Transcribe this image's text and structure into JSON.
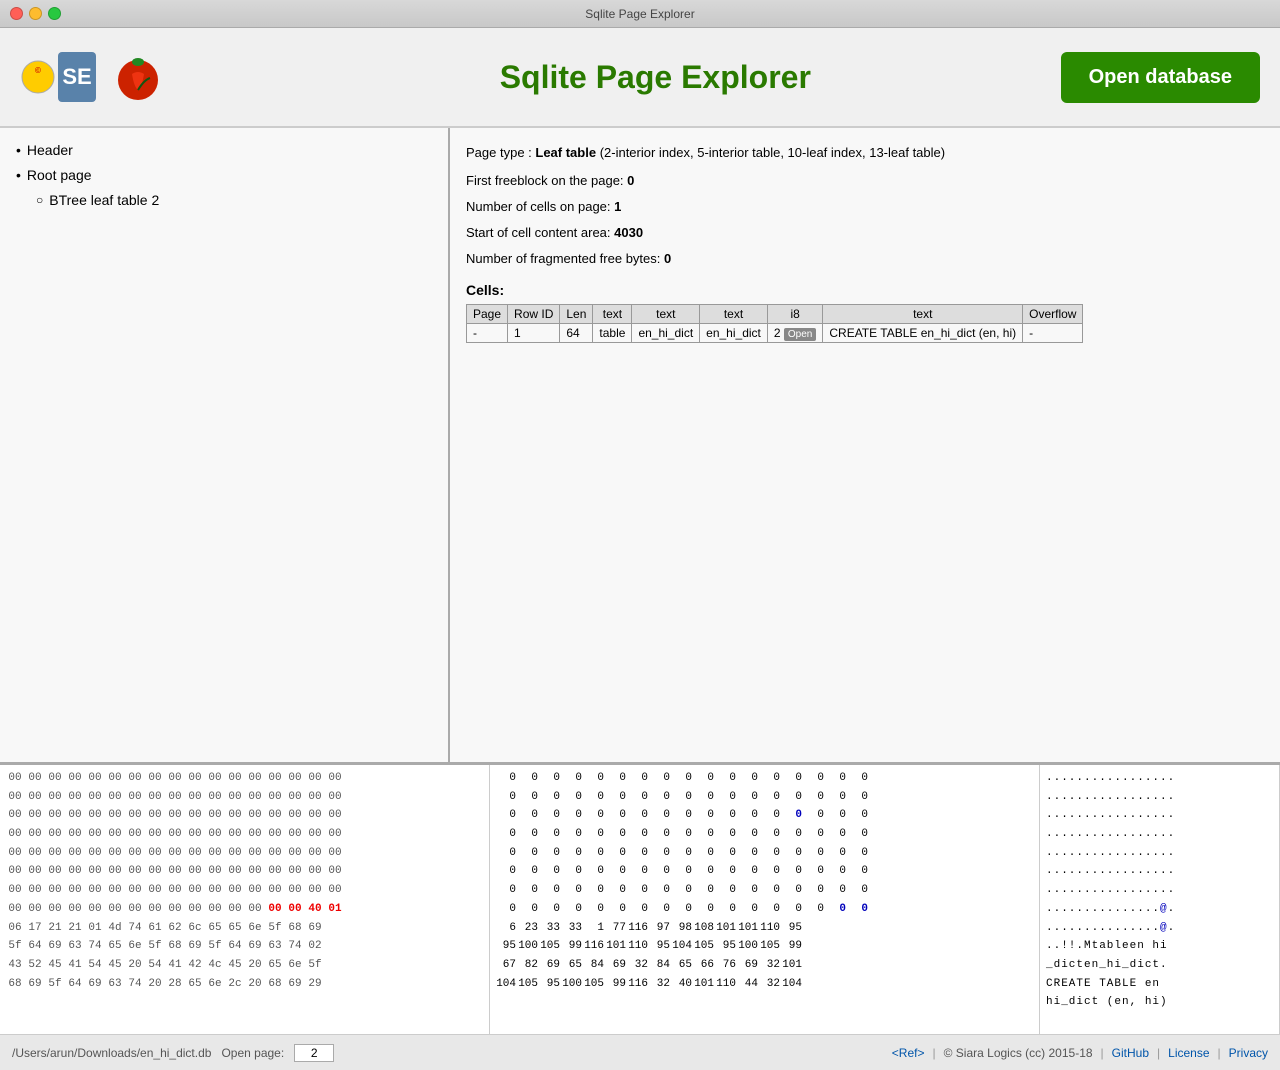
{
  "window": {
    "title": "Sqlite Page Explorer"
  },
  "header": {
    "app_title": "Sqlite Page Explorer",
    "open_db_label": "Open database"
  },
  "tree": {
    "items": [
      {
        "label": "Header",
        "bullet": "•"
      },
      {
        "label": "Root page",
        "bullet": "•",
        "children": [
          {
            "label": "BTree leaf table 2",
            "bullet": "○"
          }
        ]
      }
    ]
  },
  "page_info": {
    "page_type_prefix": "Page type : ",
    "page_type_bold": "Leaf table",
    "page_type_suffix": " (2-interior index, 5-interior table, 10-leaf index, 13-leaf table)",
    "freeblock_prefix": "First freeblock on the page: ",
    "freeblock_value": "0",
    "cells_prefix": "Number of cells on page: ",
    "cells_value": "1",
    "cell_content_prefix": "Start of cell content area: ",
    "cell_content_value": "4030",
    "fragmented_prefix": "Number of fragmented free bytes: ",
    "fragmented_value": "0"
  },
  "cells_table": {
    "title": "Cells:",
    "headers": [
      "Page",
      "Row ID",
      "Len",
      "text",
      "text",
      "text",
      "i8",
      "text",
      "Overflow"
    ],
    "rows": [
      [
        "-",
        "1",
        "64",
        "table",
        "en_hi_dict",
        "en_hi_dict",
        "2",
        "Open",
        "CREATE TABLE en_hi_dict (en, hi)",
        "-"
      ]
    ]
  },
  "hex_panel": {
    "rows": [
      {
        "hex": [
          "00",
          "00",
          "00",
          "00",
          "00",
          "00",
          "00",
          "00",
          "00",
          "00",
          "00",
          "00",
          "00",
          "00",
          "00",
          "00",
          "00"
        ],
        "dec": [
          "0",
          "0",
          "0",
          "0",
          "0",
          "0",
          "0",
          "0",
          "0",
          "0",
          "0",
          "0",
          "0",
          "0",
          "0",
          "0",
          "0"
        ],
        "ascii": "................."
      },
      {
        "hex": [
          "00",
          "00",
          "00",
          "00",
          "00",
          "00",
          "00",
          "00",
          "00",
          "00",
          "00",
          "00",
          "00",
          "00",
          "00",
          "00",
          "00"
        ],
        "dec": [
          "0",
          "0",
          "0",
          "0",
          "0",
          "0",
          "0",
          "0",
          "0",
          "0",
          "0",
          "0",
          "0",
          "0",
          "0",
          "0",
          "0"
        ],
        "ascii": "................."
      },
      {
        "hex": [
          "00",
          "00",
          "00",
          "00",
          "00",
          "00",
          "00",
          "00",
          "00",
          "00",
          "00",
          "00",
          "00",
          "00",
          "00",
          "00",
          "00"
        ],
        "dec": [
          "0",
          "0",
          "0",
          "0",
          "0",
          "0",
          "0",
          "0",
          "0",
          "0",
          "0",
          "0",
          "0",
          "0",
          "0",
          "0",
          "0"
        ],
        "ascii": "................."
      },
      {
        "hex": [
          "00",
          "00",
          "00",
          "00",
          "00",
          "00",
          "00",
          "00",
          "00",
          "00",
          "00",
          "00",
          "00",
          "00",
          "00",
          "00",
          "00"
        ],
        "dec": [
          "0",
          "0",
          "0",
          "0",
          "0",
          "0",
          "0",
          "0",
          "0",
          "0",
          "0",
          "0",
          "0",
          "0",
          "0",
          "0",
          "0"
        ],
        "ascii": "................."
      },
      {
        "hex": [
          "00",
          "00",
          "00",
          "00",
          "00",
          "00",
          "00",
          "00",
          "00",
          "00",
          "00",
          "00",
          "00",
          "00",
          "00",
          "00",
          "00"
        ],
        "dec": [
          "0",
          "0",
          "0",
          "0",
          "0",
          "0",
          "0",
          "0",
          "0",
          "0",
          "0",
          "0",
          "0",
          "0",
          "0",
          "0",
          "0"
        ],
        "ascii": "................."
      },
      {
        "hex": [
          "00",
          "00",
          "00",
          "00",
          "00",
          "00",
          "00",
          "00",
          "00",
          "00",
          "00",
          "00",
          "00",
          "00",
          "00",
          "00",
          "00"
        ],
        "dec": [
          "0",
          "0",
          "0",
          "0",
          "0",
          "0",
          "0",
          "0",
          "0",
          "0",
          "0",
          "0",
          "0",
          "0",
          "0",
          "0",
          "0"
        ],
        "ascii": "................."
      },
      {
        "hex": [
          "00",
          "00",
          "00",
          "00",
          "00",
          "00",
          "00",
          "00",
          "00",
          "00",
          "00",
          "00",
          "00",
          "00",
          "00",
          "00",
          "00"
        ],
        "dec": [
          "0",
          "0",
          "0",
          "0",
          "0",
          "0",
          "0",
          "0",
          "0",
          "0",
          "0",
          "0",
          "0",
          "0",
          "0",
          "0",
          "0"
        ],
        "ascii": "................."
      },
      {
        "hex": [
          "00",
          "00",
          "00",
          "00",
          "00",
          "00",
          "00",
          "00",
          "00",
          "00",
          "00",
          "00",
          "00",
          "40",
          "01"
        ],
        "dec": [
          "0",
          "0",
          "0",
          "0",
          "0",
          "0",
          "0",
          "0",
          "0",
          "0",
          "0",
          "0",
          "0",
          "0",
          "0"
        ],
        "ascii": "...............",
        "hex_highlights": [
          13,
          14
        ]
      },
      {
        "hex": [
          "06",
          "17",
          "21",
          "21",
          "01",
          "4d",
          "74",
          "61",
          "62",
          "6c",
          "65",
          "65",
          "6e",
          "5f",
          "68",
          "69"
        ],
        "dec": [
          "6",
          "23",
          "33",
          "33",
          "1",
          "77",
          "116",
          "97",
          "98",
          "108",
          "101",
          "101",
          "110",
          "95"
        ],
        "ascii": "..............@.",
        "dec_highlights": []
      },
      {
        "hex": [
          "5f",
          "64",
          "69",
          "63",
          "74",
          "65",
          "6e",
          "5f",
          "68",
          "69",
          "5f",
          "64",
          "69",
          "63",
          "74",
          "02"
        ],
        "dec": [
          "95",
          "100",
          "105",
          "99",
          "116",
          "101",
          "110",
          "95",
          "104",
          "105",
          "95",
          "100",
          "105",
          "99"
        ],
        "ascii": "..!!.Mtableen hi"
      },
      {
        "hex": [
          "43",
          "52",
          "45",
          "41",
          "54",
          "45",
          "20",
          "54",
          "41",
          "42",
          "4c",
          "45",
          "20",
          "65",
          "6e",
          "5f"
        ],
        "dec": [
          "67",
          "82",
          "69",
          "65",
          "84",
          "69",
          "32",
          "84",
          "65",
          "66",
          "76",
          "69",
          "32",
          "101"
        ],
        "ascii": "_dicten_hi_dict."
      },
      {
        "hex": [
          "68",
          "69",
          "5f",
          "64",
          "69",
          "63",
          "74",
          "20",
          "28",
          "65",
          "6e",
          "2c",
          "20",
          "68",
          "69",
          "29"
        ],
        "dec": [
          "104",
          "105",
          "95",
          "100",
          "105",
          "99",
          "116",
          "32",
          "40",
          "101",
          "110",
          "44",
          "32",
          "104"
        ],
        "ascii": "CREATE TABLE en"
      }
    ]
  },
  "footer": {
    "file_path": "/Users/arun/Downloads/en_hi_dict.db",
    "open_page_label": "Open page:",
    "open_page_value": "2",
    "ref_label": "<Ref>",
    "copyright": "© Siara Logics (cc) 2015-18",
    "github_label": "GitHub",
    "license_label": "License",
    "privacy_label": "Privacy"
  }
}
